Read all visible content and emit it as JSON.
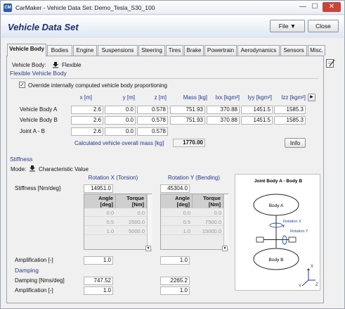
{
  "window": {
    "app_label": "CM",
    "title": "CarMaker - Vehicle Data Set: Demo_Tesla_S30_100",
    "minimize": "—",
    "maximize": "☐",
    "close": "✕"
  },
  "header": {
    "title": "Vehicle Data Set",
    "file_button": "File ▼",
    "close_button": "Close"
  },
  "tabs": [
    "Vehicle Body",
    "Bodies",
    "Engine",
    "Suspensions",
    "Steering",
    "Tires",
    "Brake",
    "Powertrain",
    "Aerodynamics",
    "Sensors",
    "Misc."
  ],
  "vehicle_body": {
    "label": "Vehicle Body:",
    "value": "Flexible"
  },
  "flexible": {
    "section_title": "Flexible Vehicle Body",
    "override_label": "Override internally computed vehicle body proportioning",
    "override_checked": true,
    "columns": [
      "x [m]",
      "y [m]",
      "z [m]",
      "Mass [kg]",
      "Ixx [kgm²]",
      "Iyy [kgm²]",
      "Izz [kgm²]"
    ],
    "rows": [
      {
        "label": "Vehicle Body A",
        "values": [
          "2.6",
          "0.0",
          "0.578",
          "751.93",
          "370.88",
          "1451.5",
          "1585.3"
        ]
      },
      {
        "label": "Vehicle Body B",
        "values": [
          "2.6",
          "0.0",
          "0.578",
          "751.93",
          "370.88",
          "1451.5",
          "1585.3"
        ]
      },
      {
        "label": "Joint A - B",
        "values": [
          "2.6",
          "0.0",
          "0.578"
        ]
      }
    ],
    "total_mass_label": "Calculated vehicle overall mass [kg]",
    "total_mass_value": "1770.00",
    "info_button": "Info"
  },
  "stiffness": {
    "section_title": "Stiffness",
    "mode_label": "Mode:",
    "mode_value": "Characteristic Value",
    "col_torsion": "Rotation X (Torsion)",
    "col_bending": "Rotation Y (Bending)",
    "stiffness_label": "Stiffness [Nm/deg]",
    "stiffness_torsion": "14951.0",
    "stiffness_bending": "45304.0",
    "table_head_angle": "Angle\n[deg]",
    "table_head_torque": "Torque\n[Nm]",
    "torsion_rows": [
      [
        "0.0",
        "0.0"
      ],
      [
        "0.5",
        "2500.0"
      ],
      [
        "1.0",
        "5000.0"
      ]
    ],
    "bending_rows": [
      [
        "0.0",
        "0.0"
      ],
      [
        "0.5",
        "7500.0"
      ],
      [
        "1.0",
        "15000.0"
      ]
    ],
    "amplification_label": "Amplification [-]",
    "amp_torsion": "1.0",
    "amp_bending": "1.0"
  },
  "damping": {
    "section_title": "Damping",
    "damping_label": "Damping [Nms/deg]",
    "damping_torsion": "747.52",
    "damping_bending": "2265.2",
    "amplification_label": "Amplification [-]",
    "amp_torsion": "1.0",
    "amp_bending": "1.0"
  },
  "diagram": {
    "title": "Joint Body A - Body B",
    "body_a": "Body A",
    "body_b": "Body B",
    "rot_x": "Rotation X",
    "rot_y": "Rotation Y",
    "axis_x": "X",
    "axis_y": "Y",
    "axis_z": "Z"
  },
  "colors": {
    "accent": "#1b2f6b",
    "section": "#2a3c86",
    "header_value": "#1f3a8a"
  },
  "icons": {
    "dropdown": "download-arrow-icon",
    "note": "notepad-icon"
  }
}
